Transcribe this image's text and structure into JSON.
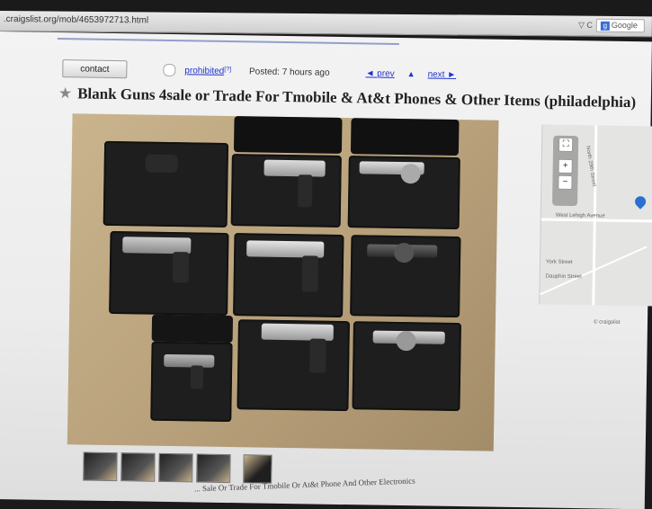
{
  "browser": {
    "url": ".craigslist.org/mob/4653972713.html",
    "reload_label": "▽ C",
    "search_placeholder": "Google"
  },
  "posting": {
    "contact_label": "contact",
    "prohibited_label": "prohibited",
    "prohibited_sup": "[?]",
    "posted_text": "Posted: 7 hours ago",
    "prev_label": "◄ prev",
    "up_label": "▲",
    "next_label": "next ►",
    "title": "Blank Guns 4sale or Trade For Tmobile & At&t Phones & Other Items (philadelphia)",
    "star_icon": "star-icon"
  },
  "map": {
    "labels": {
      "street1": "North 29th Street",
      "street2": "West Lehigh Avenue",
      "street3": "York Street",
      "street4": "Dauphin Street",
      "credit": "© craigslist"
    }
  },
  "footer": {
    "caption": "... Sale Or Trade For Tmobile Or At&t Phone And Other Electronics"
  }
}
